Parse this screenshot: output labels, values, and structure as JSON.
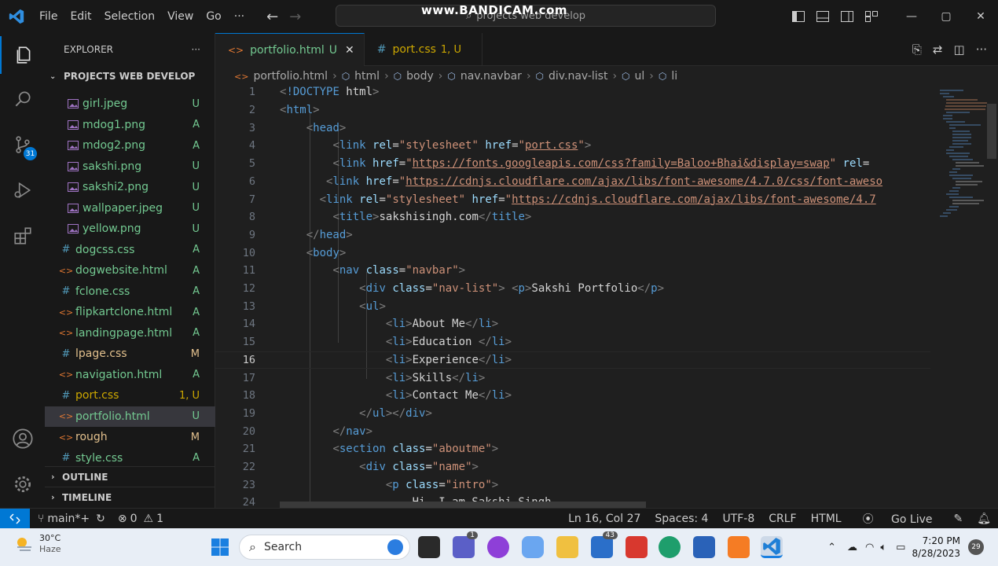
{
  "titlebar": {
    "menu": [
      "File",
      "Edit",
      "Selection",
      "View",
      "Go",
      "···"
    ],
    "search_text": "projects web develop",
    "watermark": "www.BANDICAM.com"
  },
  "activity": {
    "scm_badge": "31"
  },
  "sidebar": {
    "title": "EXPLORER",
    "more": "···",
    "project": "PROJECTS WEB DEVELOP",
    "files": [
      {
        "name": "girl.jpeg",
        "status": "U",
        "kind": "img"
      },
      {
        "name": "mdog1.png",
        "status": "A",
        "kind": "img"
      },
      {
        "name": "mdog2.png",
        "status": "A",
        "kind": "img"
      },
      {
        "name": "sakshi.png",
        "status": "U",
        "kind": "img"
      },
      {
        "name": "sakshi2.png",
        "status": "U",
        "kind": "img"
      },
      {
        "name": "wallpaper.jpeg",
        "status": "U",
        "kind": "img"
      },
      {
        "name": "yellow.png",
        "status": "U",
        "kind": "img"
      },
      {
        "name": "dogcss.css",
        "status": "A",
        "kind": "css"
      },
      {
        "name": "dogwebsite.html",
        "status": "A",
        "kind": "html"
      },
      {
        "name": "fclone.css",
        "status": "A",
        "kind": "css"
      },
      {
        "name": "flipkartclone.html",
        "status": "A",
        "kind": "html"
      },
      {
        "name": "landingpage.html",
        "status": "A",
        "kind": "html"
      },
      {
        "name": "lpage.css",
        "status": "M",
        "kind": "css"
      },
      {
        "name": "navigation.html",
        "status": "A",
        "kind": "html"
      },
      {
        "name": "port.css",
        "status": "1, U",
        "kind": "css"
      },
      {
        "name": "portfolio.html",
        "status": "U",
        "kind": "html"
      },
      {
        "name": "rough",
        "status": "M",
        "kind": "html"
      },
      {
        "name": "style.css",
        "status": "A",
        "kind": "css"
      }
    ],
    "outline": "OUTLINE",
    "timeline": "TIMELINE"
  },
  "tabs": [
    {
      "label": "portfolio.html",
      "status": "U",
      "close": "✕"
    },
    {
      "label": "port.css",
      "status": "1, U"
    }
  ],
  "breadcrumb": [
    "portfolio.html",
    "html",
    "body",
    "nav.navbar",
    "div.nav-list",
    "ul",
    "li"
  ],
  "code": {
    "current_line": 16,
    "lines": [
      [
        [
          "br",
          "<"
        ],
        [
          "tag",
          "!DOCTYPE"
        ],
        [
          "txt",
          " html"
        ],
        [
          "br",
          ">"
        ]
      ],
      [
        [
          "br",
          "<"
        ],
        [
          "tag",
          "html"
        ],
        [
          "br",
          ">"
        ]
      ],
      [
        [
          "txt",
          "    "
        ],
        [
          "br",
          "<"
        ],
        [
          "tag",
          "head"
        ],
        [
          "br",
          ">"
        ]
      ],
      [
        [
          "txt",
          "        "
        ],
        [
          "br",
          "<"
        ],
        [
          "tag",
          "link"
        ],
        [
          "txt",
          " "
        ],
        [
          "attr",
          "rel"
        ],
        [
          "txt",
          "="
        ],
        [
          "str",
          "\"stylesheet\""
        ],
        [
          "txt",
          " "
        ],
        [
          "attr",
          "href"
        ],
        [
          "txt",
          "="
        ],
        [
          "str",
          "\""
        ],
        [
          "url",
          "port.css"
        ],
        [
          "str",
          "\""
        ],
        [
          "br",
          ">"
        ]
      ],
      [
        [
          "txt",
          "        "
        ],
        [
          "br",
          "<"
        ],
        [
          "tag",
          "link"
        ],
        [
          "txt",
          " "
        ],
        [
          "attr",
          "href"
        ],
        [
          "txt",
          "="
        ],
        [
          "str",
          "\""
        ],
        [
          "url",
          "https://fonts.googleapis.com/css?family=Baloo+Bhai&display=swap"
        ],
        [
          "str",
          "\""
        ],
        [
          "txt",
          " "
        ],
        [
          "attr",
          "rel"
        ],
        [
          "txt",
          "="
        ]
      ],
      [
        [
          "txt",
          "       "
        ],
        [
          "br",
          "<"
        ],
        [
          "tag",
          "link"
        ],
        [
          "txt",
          " "
        ],
        [
          "attr",
          "href"
        ],
        [
          "txt",
          "="
        ],
        [
          "str",
          "\""
        ],
        [
          "url",
          "https://cdnjs.cloudflare.com/ajax/libs/font-awesome/4.7.0/css/font-aweso"
        ]
      ],
      [
        [
          "txt",
          "      "
        ],
        [
          "br",
          "<"
        ],
        [
          "tag",
          "link"
        ],
        [
          "txt",
          " "
        ],
        [
          "attr",
          "rel"
        ],
        [
          "txt",
          "="
        ],
        [
          "str",
          "\"stylesheet\""
        ],
        [
          "txt",
          " "
        ],
        [
          "attr",
          "href"
        ],
        [
          "txt",
          "="
        ],
        [
          "str",
          "\""
        ],
        [
          "url",
          "https://cdnjs.cloudflare.com/ajax/libs/font-awesome/4.7"
        ]
      ],
      [
        [
          "txt",
          "        "
        ],
        [
          "br",
          "<"
        ],
        [
          "tag",
          "title"
        ],
        [
          "br",
          ">"
        ],
        [
          "txt",
          "sakshisingh.com"
        ],
        [
          "br",
          "</"
        ],
        [
          "tag",
          "title"
        ],
        [
          "br",
          ">"
        ]
      ],
      [
        [
          "txt",
          "    "
        ],
        [
          "br",
          "</"
        ],
        [
          "tag",
          "head"
        ],
        [
          "br",
          ">"
        ]
      ],
      [
        [
          "txt",
          "    "
        ],
        [
          "br",
          "<"
        ],
        [
          "tag",
          "body"
        ],
        [
          "br",
          ">"
        ]
      ],
      [
        [
          "txt",
          "        "
        ],
        [
          "br",
          "<"
        ],
        [
          "tag",
          "nav"
        ],
        [
          "txt",
          " "
        ],
        [
          "attr",
          "class"
        ],
        [
          "txt",
          "="
        ],
        [
          "str",
          "\"navbar\""
        ],
        [
          "br",
          ">"
        ]
      ],
      [
        [
          "txt",
          "            "
        ],
        [
          "br",
          "<"
        ],
        [
          "tag",
          "div"
        ],
        [
          "txt",
          " "
        ],
        [
          "attr",
          "class"
        ],
        [
          "txt",
          "="
        ],
        [
          "str",
          "\"nav-list\""
        ],
        [
          "br",
          ">"
        ],
        [
          "txt",
          " "
        ],
        [
          "br",
          "<"
        ],
        [
          "tag",
          "p"
        ],
        [
          "br",
          ">"
        ],
        [
          "txt",
          "Sakshi Portfolio"
        ],
        [
          "br",
          "</"
        ],
        [
          "tag",
          "p"
        ],
        [
          "br",
          ">"
        ]
      ],
      [
        [
          "txt",
          "            "
        ],
        [
          "br",
          "<"
        ],
        [
          "tag",
          "ul"
        ],
        [
          "br",
          ">"
        ]
      ],
      [
        [
          "txt",
          "                "
        ],
        [
          "br",
          "<"
        ],
        [
          "tag",
          "li"
        ],
        [
          "br",
          ">"
        ],
        [
          "txt",
          "About Me"
        ],
        [
          "br",
          "</"
        ],
        [
          "tag",
          "li"
        ],
        [
          "br",
          ">"
        ]
      ],
      [
        [
          "txt",
          "                "
        ],
        [
          "br",
          "<"
        ],
        [
          "tag",
          "li"
        ],
        [
          "br",
          ">"
        ],
        [
          "txt",
          "Education "
        ],
        [
          "br",
          "</"
        ],
        [
          "tag",
          "li"
        ],
        [
          "br",
          ">"
        ]
      ],
      [
        [
          "txt",
          "                "
        ],
        [
          "br",
          "<"
        ],
        [
          "tag",
          "li"
        ],
        [
          "br",
          ">"
        ],
        [
          "txt",
          "Experience"
        ],
        [
          "br",
          "</"
        ],
        [
          "tag",
          "li"
        ],
        [
          "br",
          ">"
        ]
      ],
      [
        [
          "txt",
          "                "
        ],
        [
          "br",
          "<"
        ],
        [
          "tag",
          "li"
        ],
        [
          "br",
          ">"
        ],
        [
          "txt",
          "Skills"
        ],
        [
          "br",
          "</"
        ],
        [
          "tag",
          "li"
        ],
        [
          "br",
          ">"
        ]
      ],
      [
        [
          "txt",
          "                "
        ],
        [
          "br",
          "<"
        ],
        [
          "tag",
          "li"
        ],
        [
          "br",
          ">"
        ],
        [
          "txt",
          "Contact Me"
        ],
        [
          "br",
          "</"
        ],
        [
          "tag",
          "li"
        ],
        [
          "br",
          ">"
        ]
      ],
      [
        [
          "txt",
          "            "
        ],
        [
          "br",
          "</"
        ],
        [
          "tag",
          "ul"
        ],
        [
          "br",
          "></"
        ],
        [
          "tag",
          "div"
        ],
        [
          "br",
          ">"
        ]
      ],
      [
        [
          "txt",
          "        "
        ],
        [
          "br",
          "</"
        ],
        [
          "tag",
          "nav"
        ],
        [
          "br",
          ">"
        ]
      ],
      [
        [
          "txt",
          "        "
        ],
        [
          "br",
          "<"
        ],
        [
          "tag",
          "section"
        ],
        [
          "txt",
          " "
        ],
        [
          "attr",
          "class"
        ],
        [
          "txt",
          "="
        ],
        [
          "str",
          "\"aboutme\""
        ],
        [
          "br",
          ">"
        ]
      ],
      [
        [
          "txt",
          "            "
        ],
        [
          "br",
          "<"
        ],
        [
          "tag",
          "div"
        ],
        [
          "txt",
          " "
        ],
        [
          "attr",
          "class"
        ],
        [
          "txt",
          "="
        ],
        [
          "str",
          "\"name\""
        ],
        [
          "br",
          ">"
        ]
      ],
      [
        [
          "txt",
          "                "
        ],
        [
          "br",
          "<"
        ],
        [
          "tag",
          "p"
        ],
        [
          "txt",
          " "
        ],
        [
          "attr",
          "class"
        ],
        [
          "txt",
          "="
        ],
        [
          "str",
          "\"intro\""
        ],
        [
          "br",
          ">"
        ]
      ],
      [
        [
          "txt",
          "                    Hi, I am Sakshi Singh-"
        ]
      ]
    ]
  },
  "statusbar": {
    "branch": "main*+",
    "errors": "0",
    "warnings": "1",
    "position": "Ln 16, Col 27",
    "spaces": "Spaces: 4",
    "encoding": "UTF-8",
    "eol": "CRLF",
    "language": "HTML",
    "golive": "Go Live"
  },
  "taskbar": {
    "temp": "30°C",
    "weather": "Haze",
    "search": "Search",
    "badge_chat": "1",
    "badge_mail": "43",
    "time": "7:20 PM",
    "date": "8/28/2023",
    "notif": "29"
  },
  "colors": {
    "accent": "#0078d4",
    "tag": "#569cd6",
    "attr": "#9cdcfe",
    "string": "#ce9178",
    "untracked": "#73c991",
    "modified": "#e2c08d"
  }
}
